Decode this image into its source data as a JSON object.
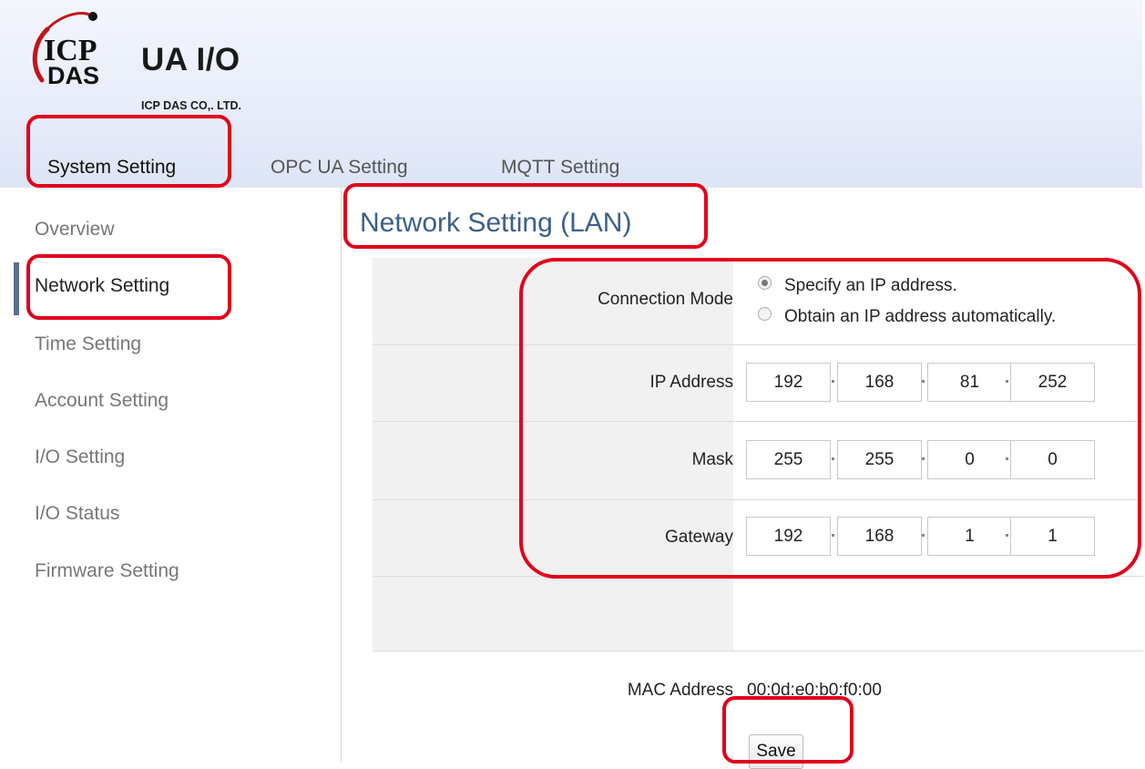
{
  "header": {
    "brand": "UA I/O",
    "company": "ICP DAS CO,. LTD.",
    "logo_text_top": "ICP",
    "logo_text_bottom": "DAS",
    "tabs": [
      {
        "label": "System Setting",
        "active": true
      },
      {
        "label": "OPC UA Setting",
        "active": false
      },
      {
        "label": "MQTT Setting",
        "active": false
      }
    ]
  },
  "sidebar": {
    "items": [
      {
        "label": "Overview"
      },
      {
        "label": "Network Setting",
        "active": true
      },
      {
        "label": "Time Setting"
      },
      {
        "label": "Account Setting"
      },
      {
        "label": "I/O Setting"
      },
      {
        "label": "I/O Status"
      },
      {
        "label": "Firmware Setting"
      }
    ]
  },
  "main": {
    "title": "Network Setting (LAN)",
    "connection_mode": {
      "label": "Connection Mode",
      "options": [
        {
          "label": "Specify an IP address.",
          "selected": true
        },
        {
          "label": "Obtain an IP address automatically.",
          "selected": false
        }
      ]
    },
    "ip_address": {
      "label": "IP Address",
      "octets": [
        "192",
        "168",
        "81",
        "252"
      ]
    },
    "mask": {
      "label": "Mask",
      "octets": [
        "255",
        "255",
        "0",
        "0"
      ]
    },
    "gateway": {
      "label": "Gateway",
      "octets": [
        "192",
        "168",
        "1",
        "1"
      ]
    },
    "mac_address": {
      "label": "MAC Address",
      "value": "00:0d:e0:b0:f0:00"
    },
    "save_label": "Save"
  },
  "colors": {
    "accent": "#5b6f8f",
    "title": "#3b5f8a",
    "highlight": "#e0001b",
    "logo_red": "#c0161b"
  }
}
